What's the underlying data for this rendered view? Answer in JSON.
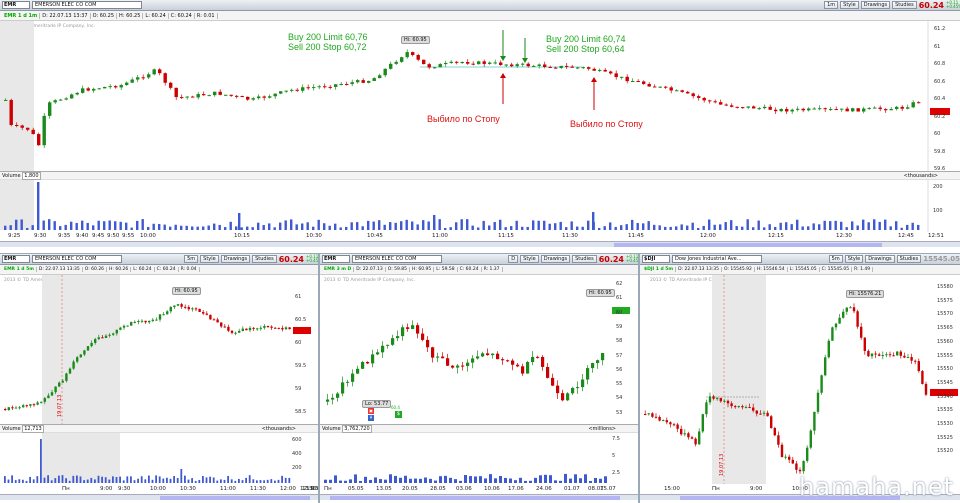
{
  "panes": {
    "top": {
      "symbol": "EMR",
      "name": "EMERSON ELEC CO COM",
      "interval": "1m",
      "style": "Style",
      "drawings": "Drawings",
      "studies": "Studies",
      "last": "60.24",
      "chg1": "+0.11",
      "chg2": "+0.45%",
      "info": [
        "EMR 1 d 1m",
        "D: 22.07.13 13:37",
        "O: 60.25",
        "H: 60.25",
        "L: 60.24",
        "C: 60.24",
        "R: 0.01"
      ],
      "copyright": "2013 © TD Ameritrade IP Company, Inc.",
      "prices": [
        "61.2",
        "61",
        "60.8",
        "60.6",
        "60.4",
        "60.2",
        "60",
        "59.8",
        "59.6"
      ],
      "hi": "Hi: 60.95",
      "vol_label": "Volume",
      "vol_value": "1,800",
      "vol_unit": "<thousands>",
      "vol_ticks": [
        "200",
        "100"
      ],
      "times": [
        "9:25",
        "9:30",
        "9:35",
        "9:40",
        "9:45",
        "9:50",
        "9:55",
        "10:00",
        "10:15",
        "10:30",
        "10:45",
        "11:00",
        "11:15",
        "11:30",
        "11:45",
        "12:00",
        "12:15",
        "12:30",
        "12:45",
        "12:51"
      ]
    },
    "bl": {
      "symbol": "EMR",
      "name": "EMERSON ELEC CO COM",
      "interval": "5m",
      "style": "Style",
      "drawings": "Drawings",
      "studies": "Studies",
      "last": "60.24",
      "chg1": "+0.11",
      "chg2": "+0.45%",
      "info": [
        "EMR 1 d 5m",
        "D: 22.07.13 13:35",
        "O: 60.26",
        "H: 60.26",
        "L: 60.24",
        "C: 60.24",
        "R: 0.04"
      ],
      "copyright": "2013 © TD Ameritrade IP Company, Inc.",
      "prices": [
        "61",
        "60.5",
        "60",
        "59.5",
        "59",
        "58.5"
      ],
      "hi": "Hi: 60.95",
      "date_mark": "19.07.13",
      "vol_label": "Volume",
      "vol_value": "12,713",
      "vol_unit": "<thousands>",
      "vol_ticks": [
        "600",
        "400",
        "200"
      ],
      "times": [
        "Пн",
        "9:00",
        "9:30",
        "10:00",
        "10:30",
        "11:00",
        "11:30",
        "12:00",
        "12:30",
        "13:00",
        "13:35"
      ]
    },
    "bm": {
      "symbol": "EMR",
      "name": "EMERSON ELEC CO COM",
      "interval": "D",
      "style": "Style",
      "drawings": "Drawings",
      "studies": "Studies",
      "last": "60.24",
      "chg1": "+0.11",
      "chg2": "+0.45%",
      "info": [
        "EMR 3 m D",
        "D: 22.07.13",
        "O: 59.85",
        "H: 60.95",
        "L: 59.58",
        "C: 60.24",
        "R: 1.37"
      ],
      "copyright": "2013 © TD Ameritrade IP Company, Inc.",
      "prices": [
        "62",
        "61",
        "60",
        "59",
        "58",
        "57",
        "56",
        "55",
        "54",
        "53"
      ],
      "hi": "Hi: 60.95",
      "lo": "Lo: 53.77",
      "lo2": "60.4",
      "vol_label": "Volume",
      "vol_value": "3,762,720",
      "vol_unit": "<millions>",
      "vol_ticks": [
        "7.5",
        "5",
        "2.5"
      ],
      "times": [
        "Пн",
        "05.05",
        "13.05",
        "20.05",
        "28.05",
        "03.06",
        "10.06",
        "17.06",
        "24.06",
        "01.07",
        "08.07",
        "15.07"
      ]
    },
    "br": {
      "symbol": "$DJI",
      "name": "Dow Jones Industrial Ave...",
      "interval": "5m",
      "style": "Style",
      "drawings": "Drawings",
      "studies": "Studies",
      "last": "15545.05",
      "info": [
        "$DJI 1 d 5m",
        "D: 22.07.13 13:35",
        "O: 15545.92",
        "H: 15546.54",
        "L: 15545.05",
        "C: 15545.05",
        "R: 1.49"
      ],
      "copyright": "2013 © TD Ameritrade IP Company, Inc.",
      "prices": [
        "15580",
        "15575",
        "15570",
        "15565",
        "15560",
        "15555",
        "15550",
        "15545",
        "15540",
        "15535",
        "15530",
        "15525",
        "15520"
      ],
      "hi": "Hi: 15576.21",
      "date_mark": "19.07.13",
      "times": [
        "15:00",
        "Пн",
        "9:00",
        "10:00"
      ]
    }
  },
  "annotations": {
    "order1": [
      "Buy 200 Limit 60,76",
      "Sell 200 Stop 60,72"
    ],
    "order2": [
      "Buy 200 Limit 60,74",
      "Sell 200 Stop 60,64"
    ],
    "stop1": "Выбило по Стопу",
    "stop2": "Выбило по Стопу"
  },
  "watermark": "hamaha.net",
  "colors": {
    "up": "#1a8a1a",
    "down": "#cc0000",
    "accent_green": "#1ea81e",
    "accent_red": "#e01010",
    "vol": "#3f5ad0"
  }
}
